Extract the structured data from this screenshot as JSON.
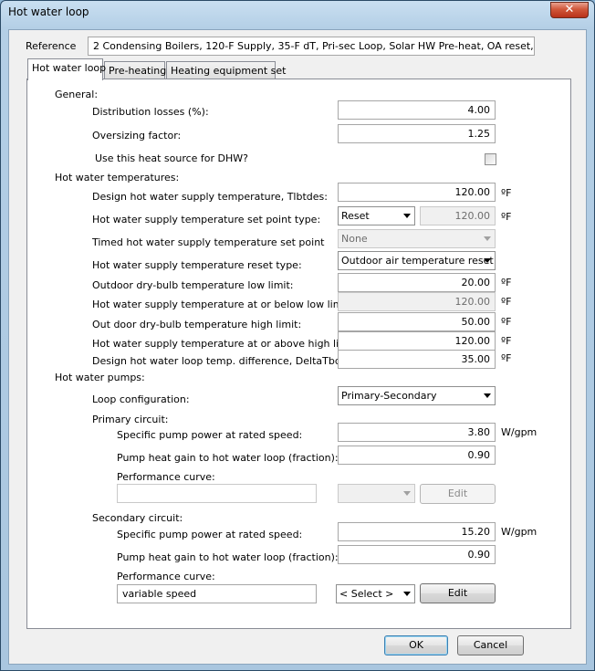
{
  "window": {
    "title": "Hot water loop",
    "close_glyph": "✕"
  },
  "reference": {
    "label": "Reference",
    "value": "2 Condensing Boilers, 120-F Supply, 35-F dT, Pri-sec Loop, Solar HW Pre-heat, OA reset, VSD sec Pu"
  },
  "tabs": [
    {
      "label": "Hot water loop",
      "active": true
    },
    {
      "label": "Pre-heating",
      "active": false
    },
    {
      "label": "Heating equipment set",
      "active": false
    }
  ],
  "general": {
    "heading": "General:",
    "distribution_losses": {
      "label": "Distribution losses (%):",
      "value": "4.00"
    },
    "oversizing_factor": {
      "label": "Oversizing factor:",
      "value": "1.25"
    },
    "dhw": {
      "label": "Use this heat source for DHW?",
      "checked": false
    }
  },
  "temps": {
    "heading": "Hot water temperatures:",
    "design_supply": {
      "label": "Design hot water supply temperature, Tlbtdes:",
      "value": "120.00",
      "unit": "ºF"
    },
    "setpoint_type": {
      "label": "Hot water supply temperature set point type:",
      "selected": "Reset",
      "value": "120.00",
      "unit": "ºF"
    },
    "timed_setpoint": {
      "label": "Timed hot water supply temperature set point",
      "selected": "None"
    },
    "reset_type": {
      "label": "Hot water supply temperature reset type:",
      "selected": "Outdoor air temperature reset"
    },
    "oa_low_limit": {
      "label": "Outdoor dry-bulb temperature low limit:",
      "value": "20.00",
      "unit": "ºF"
    },
    "supply_at_low": {
      "label": "Hot water supply temperature at or below low limit:",
      "value": "120.00",
      "unit": "ºF"
    },
    "oa_high_limit": {
      "label": "Out door dry-bulb temperature high limit:",
      "value": "50.00",
      "unit": "ºF"
    },
    "supply_at_high": {
      "label": "Hot water supply temperature at or above high limit:",
      "value": "120.00",
      "unit": "ºF"
    },
    "loop_delta": {
      "label": "Design hot water loop temp. difference, DeltaTbdes:",
      "value": "35.00",
      "unit": "ºF"
    }
  },
  "pumps": {
    "heading": "Hot water pumps:",
    "loop_config": {
      "label": "Loop configuration:",
      "selected": "Primary-Secondary"
    },
    "primary": {
      "heading": "Primary circuit:",
      "pump_power": {
        "label": "Specific pump power at rated speed:",
        "value": "3.80",
        "unit": "W/gpm"
      },
      "heat_gain": {
        "label": "Pump heat gain to hot water loop (fraction):",
        "value": "0.90"
      },
      "curve": {
        "label": "Performance curve:",
        "value": "",
        "selected": "",
        "edit_label": "Edit"
      }
    },
    "secondary": {
      "heading": "Secondary circuit:",
      "pump_power": {
        "label": "Specific pump power at rated speed:",
        "value": "15.20",
        "unit": "W/gpm"
      },
      "heat_gain": {
        "label": "Pump heat gain to hot water loop (fraction):",
        "value": "0.90"
      },
      "curve": {
        "label": "Performance curve:",
        "value": "variable speed",
        "selected": "< Select >",
        "edit_label": "Edit"
      }
    }
  },
  "footer": {
    "ok_label": "OK",
    "cancel_label": "Cancel"
  },
  "colors": {
    "title_gradient_top": "#c9dff1",
    "close_red": "#d0573a",
    "default_button_border": "#3c7fb1"
  }
}
